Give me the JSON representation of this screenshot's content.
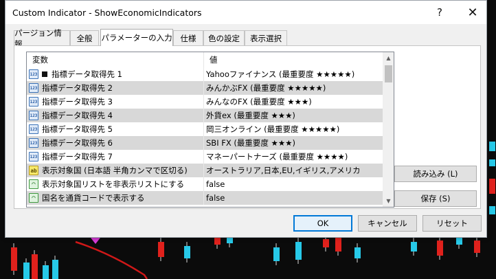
{
  "window": {
    "title": "Custom Indicator - ShowEconomicIndicators",
    "help_glyph": "?",
    "close_glyph": "✕"
  },
  "tabs": [
    {
      "label": "パージョン情報",
      "active": false
    },
    {
      "label": "全般",
      "active": false
    },
    {
      "label": "パラメーターの入力",
      "active": true
    },
    {
      "label": "仕様",
      "active": false
    },
    {
      "label": "色の設定",
      "active": false
    },
    {
      "label": "表示選択",
      "active": false
    }
  ],
  "grid": {
    "headers": {
      "variable": "変数",
      "value": "値"
    },
    "rows": [
      {
        "icon": "int-123-icon",
        "icon_text": "123",
        "variable": "指標データ取得先 1",
        "value": "Yahooファイナンス (最重要度 ★★★★★)",
        "marker": true
      },
      {
        "icon": "int-123-icon",
        "icon_text": "123",
        "variable": "指標データ取得先 2",
        "value": "みんかぶFX (最重要度 ★★★★★)"
      },
      {
        "icon": "int-123-icon",
        "icon_text": "123",
        "variable": "指標データ取得先 3",
        "value": "みんなのFX (最重要度 ★★★)"
      },
      {
        "icon": "int-123-icon",
        "icon_text": "123",
        "variable": "指標データ取得先 4",
        "value": "外貨ex (最重要度 ★★★)"
      },
      {
        "icon": "int-123-icon",
        "icon_text": "123",
        "variable": "指標データ取得先 5",
        "value": "岡三オンライン (最重要度 ★★★★★)"
      },
      {
        "icon": "int-123-icon",
        "icon_text": "123",
        "variable": "指標データ取得先 6",
        "value": "SBI FX (最重要度 ★★★)"
      },
      {
        "icon": "int-123-icon",
        "icon_text": "123",
        "variable": "指標データ取得先 7",
        "value": "マネーパートナーズ (最重要度 ★★★★)"
      },
      {
        "icon": "string-ab-icon",
        "icon_text": "ab",
        "variable": "表示対象国 (日本語 半角カンマで区切る)",
        "value": "オーストラリア,日本,EU,イギリス,アメリカ"
      },
      {
        "icon": "bool-icon",
        "icon_text": "⌒",
        "variable": "表示対象国リストを非表示リストにする",
        "value": "false"
      },
      {
        "icon": "bool-icon",
        "icon_text": "⌒",
        "variable": "国名を通貨コードで表示する",
        "value": "false"
      }
    ]
  },
  "side_buttons": {
    "load": "読み込み (L)",
    "save": "保存 (S)"
  },
  "footer_buttons": {
    "ok": "OK",
    "cancel": "キャンセル",
    "reset": "リセット"
  },
  "colors": {
    "accent": "#0078d7",
    "alt_row": "#d8d8d8",
    "bear_candle": "#e0211c",
    "bull_candle": "#27c9e8",
    "ma_line": "#d01818",
    "arrow": "#d63bd6"
  }
}
